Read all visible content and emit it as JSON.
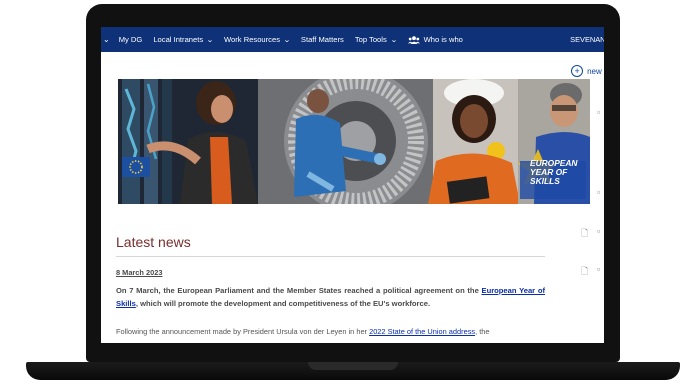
{
  "nav": {
    "items": [
      {
        "label": "My DG",
        "dropdown": false
      },
      {
        "label": "Local Intranets",
        "dropdown": true
      },
      {
        "label": "Work Resources",
        "dropdown": true
      },
      {
        "label": "Staff Matters",
        "dropdown": false
      },
      {
        "label": "Top Tools",
        "dropdown": true
      },
      {
        "label": "Who is who",
        "dropdown": false,
        "icon": "people-icon"
      }
    ],
    "user": "SEVENANT"
  },
  "new_link_label": "new lin",
  "banner": {
    "line1": "EUROPEAN",
    "line2": "YEAR OF",
    "line3": "SKILLS"
  },
  "news": {
    "heading": "Latest news",
    "date": "8 March 2023",
    "lead_before": "On 7 March, the European Parliament and the Member States reached a political agreement on the ",
    "lead_link": "European Year of Skills",
    "lead_after": ", which will promote the development and competitiveness of the EU's workforce.",
    "para_before": "Following the announcement made by President Ursula von der Leyen in her ",
    "para_link": "2022 State of the Union address",
    "para_after": ", the"
  },
  "colors": {
    "nav_bg": "#0e3178",
    "heading": "#7a2d2d",
    "link": "#0a2ea8"
  }
}
